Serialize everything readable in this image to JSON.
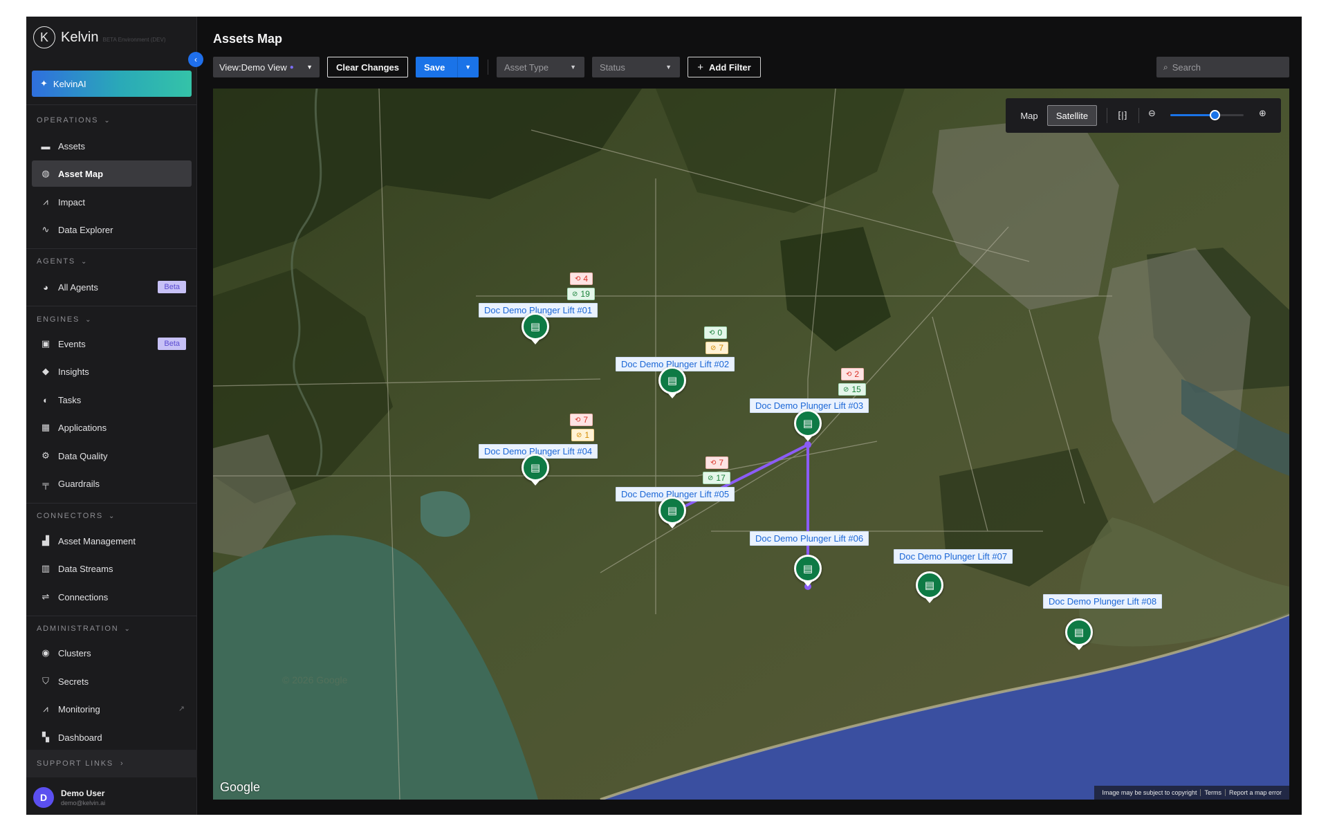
{
  "app": {
    "logo_mark": "K",
    "name": "Kelvin",
    "env": "BETA Environment (DEV)",
    "collapse_icon": "‹",
    "ai_label": "KelvinAI"
  },
  "sidebar": {
    "sections": {
      "operations": "OPERATIONS",
      "agents": "AGENTS",
      "engines": "ENGINES",
      "connectors": "CONNECTORS",
      "administration": "ADMINISTRATION"
    },
    "items": {
      "assets": "Assets",
      "asset_map": "Asset Map",
      "impact": "Impact",
      "data_explorer": "Data Explorer",
      "all_agents": "All Agents",
      "events": "Events",
      "insights": "Insights",
      "tasks": "Tasks",
      "applications": "Applications",
      "data_quality": "Data Quality",
      "guardrails": "Guardrails",
      "asset_management": "Asset Management",
      "data_streams": "Data Streams",
      "connections": "Connections",
      "clusters": "Clusters",
      "secrets": "Secrets",
      "monitoring": "Monitoring",
      "dashboard": "Dashboard"
    },
    "beta_badge": "Beta",
    "support_links": "SUPPORT LINKS",
    "user": {
      "initial": "D",
      "name": "Demo User",
      "email": "demo@kelvin.ai"
    }
  },
  "header": {
    "title": "Assets Map",
    "view_prefix": "View:",
    "view_value": "Demo View",
    "clear_changes": "Clear Changes",
    "save": "Save",
    "asset_type_placeholder": "Asset Type",
    "status_placeholder": "Status",
    "add_filter": "Add Filter",
    "search_placeholder": "Search"
  },
  "map_controls": {
    "map": "Map",
    "satellite": "Satellite",
    "selected_mode": "Satellite",
    "zoom_level_fraction": 0.6
  },
  "assets": [
    {
      "name": "Doc Demo Plunger Lift #01",
      "chips": [
        {
          "kind": "red",
          "value": "4"
        },
        {
          "kind": "green",
          "value": "19"
        }
      ]
    },
    {
      "name": "Doc Demo Plunger Lift #02",
      "chips": [
        {
          "kind": "green",
          "value": "0"
        },
        {
          "kind": "amber",
          "value": "7"
        }
      ]
    },
    {
      "name": "Doc Demo Plunger Lift #03",
      "chips": [
        {
          "kind": "red",
          "value": "2"
        },
        {
          "kind": "green",
          "value": "15"
        }
      ]
    },
    {
      "name": "Doc Demo Plunger Lift #04",
      "chips": [
        {
          "kind": "red",
          "value": "7"
        },
        {
          "kind": "amber",
          "value": "1"
        }
      ]
    },
    {
      "name": "Doc Demo Plunger Lift #05",
      "chips": [
        {
          "kind": "red",
          "value": "7"
        },
        {
          "kind": "green",
          "value": "17"
        }
      ]
    },
    {
      "name": "Doc Demo Plunger Lift #06",
      "chips": []
    },
    {
      "name": "Doc Demo Plunger Lift #07",
      "chips": []
    },
    {
      "name": "Doc Demo Plunger Lift #08",
      "chips": []
    }
  ],
  "map_footer": {
    "logo": "Google",
    "attrib1": "Image may be subject to copyright",
    "attrib2": "Terms",
    "attrib3": "Report a map error"
  },
  "colors": {
    "accent": "#1a73e8",
    "pin": "#0e7a45",
    "connection": "#8b5cf6"
  }
}
